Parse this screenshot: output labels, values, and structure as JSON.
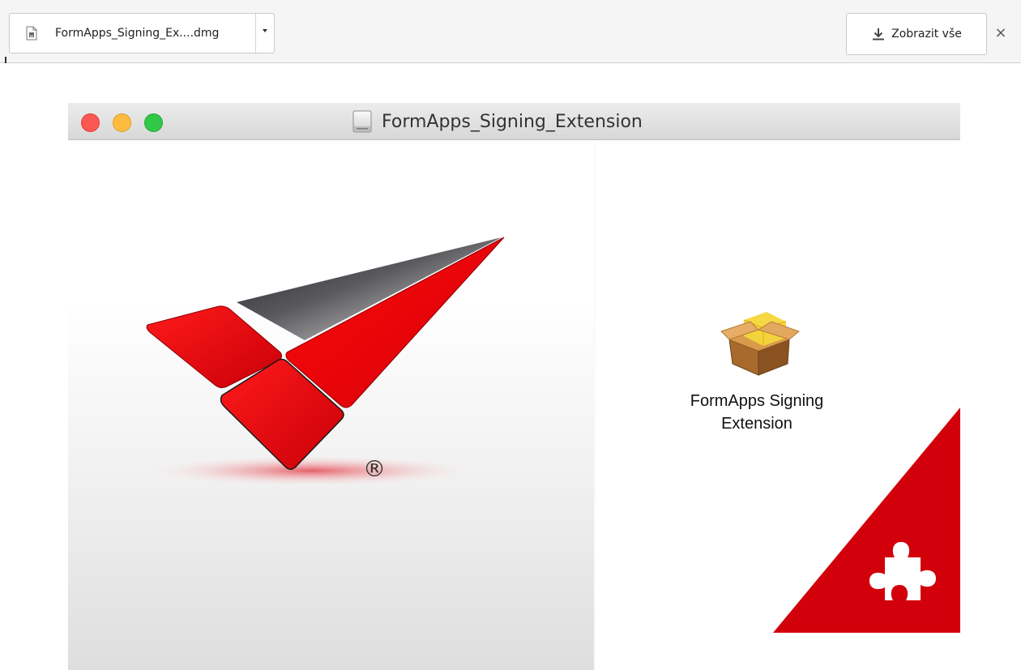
{
  "download_bar": {
    "file_name": "FormApps_Signing_Ex....dmg",
    "show_all_label": "Zobrazit vše",
    "close_symbol": "×",
    "icons": {
      "file": "file-icon",
      "dropdown": "chevron-down-icon",
      "download": "download-icon",
      "close": "close-icon"
    }
  },
  "window": {
    "title": "FormApps_Signing_Extension",
    "title_icon": "disk-image-icon",
    "traffic_lights": {
      "close_color": "#fc5753",
      "minimize_color": "#fdbc40",
      "zoom_color": "#33c748"
    },
    "logo": {
      "registered_mark": "®",
      "brand_color": "#e8000b"
    },
    "package": {
      "icon": "installer-package-icon",
      "label_line1": "FormApps Signing",
      "label_line2": "Extension"
    },
    "corner_badge": {
      "icon": "puzzle-piece-icon",
      "color": "#d1000a"
    }
  }
}
